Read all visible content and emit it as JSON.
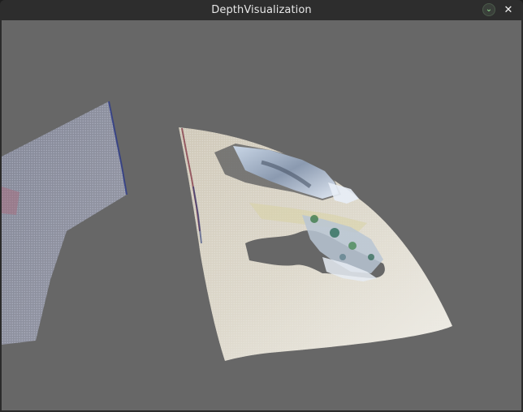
{
  "window": {
    "title": "DepthVisualization",
    "minimize_icon": "chevron-down-icon",
    "close_icon": "close-icon",
    "close_glyph": "✕",
    "minimize_glyph": "⌄"
  },
  "viewport": {
    "background": "#676767",
    "content": "point-cloud-render"
  },
  "colors": {
    "titlebar": "#2d2d2d",
    "title_text": "#e6e6e6",
    "viewport_bg": "#676767"
  }
}
